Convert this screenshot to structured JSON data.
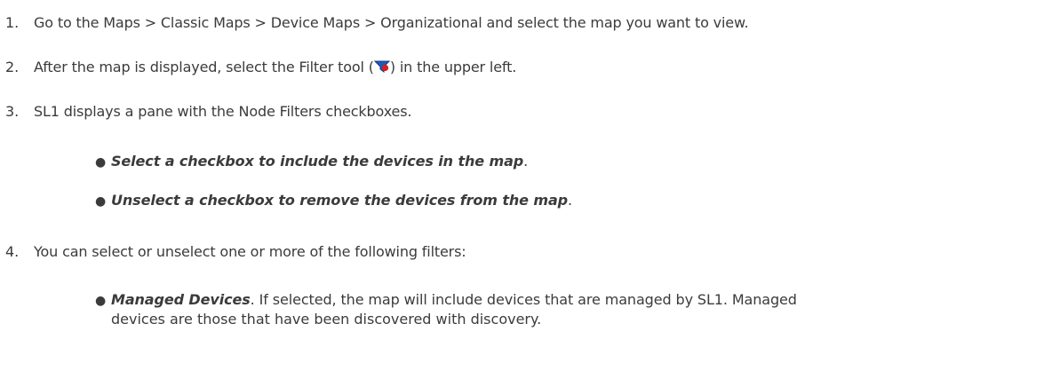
{
  "steps": [
    {
      "num": "1.",
      "text": "Go to the Maps > Classic Maps > Device Maps > Organizational and select the map you want to view."
    },
    {
      "num": "2.",
      "text_before": "After the map is displayed, select the Filter tool (",
      "text_after": ") in the upper left.",
      "icon": "filter-icon"
    },
    {
      "num": "3.",
      "text": "SL1 displays a pane with the Node Filters checkboxes.",
      "bullets": [
        {
          "bold": "Select a checkbox to include the devices in the map",
          "rest": "."
        },
        {
          "bold": "Unselect a checkbox to remove the devices from the map",
          "rest": "."
        }
      ]
    },
    {
      "num": "4.",
      "text": "You can select or unselect one or more of the following filters:",
      "bullets": [
        {
          "bold": "Managed Devices",
          "rest": ". If selected, the map will include devices that are managed by SL1. Managed",
          "rest2": "devices are those that have been discovered with discovery."
        }
      ]
    }
  ],
  "colors": {
    "text": "#3b3b3b",
    "icon_blue": "#1f5bb8",
    "icon_red": "#e01b1b"
  }
}
